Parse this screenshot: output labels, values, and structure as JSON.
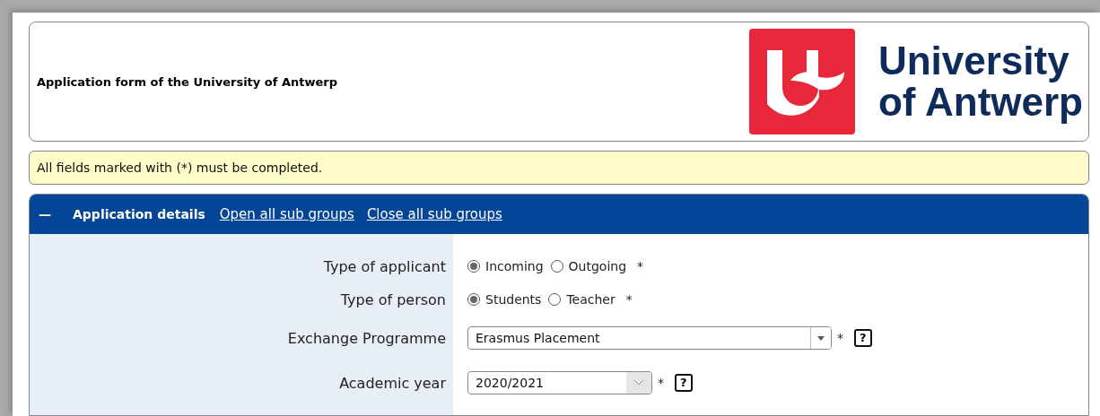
{
  "header": {
    "title": "Application form of the University of Antwerp",
    "logo_text": [
      "University",
      "of Antwerp"
    ]
  },
  "notice": "All fields marked with (*) must be completed.",
  "panel": {
    "toggle": "—",
    "expanded": true,
    "title": "Application details",
    "links": [
      "Open all sub groups",
      "Close all sub groups"
    ],
    "fields": [
      {
        "kind": "radio",
        "label": "Type of applicant",
        "options": [
          {
            "label": "Incoming",
            "selected": true
          },
          {
            "label": "Outgoing",
            "selected": false
          }
        ],
        "required": "*"
      },
      {
        "kind": "radio",
        "label": "Type of person",
        "options": [
          {
            "label": "Students",
            "selected": true
          },
          {
            "label": "Teacher",
            "selected": false
          }
        ],
        "required": "*"
      },
      {
        "kind": "dropdown",
        "label": "Exchange Programme",
        "value": "Erasmus Placement",
        "required": "*",
        "help": "?"
      },
      {
        "kind": "select",
        "label": "Academic year",
        "value": "2020/2021",
        "required": "*",
        "help": "?"
      }
    ]
  }
}
